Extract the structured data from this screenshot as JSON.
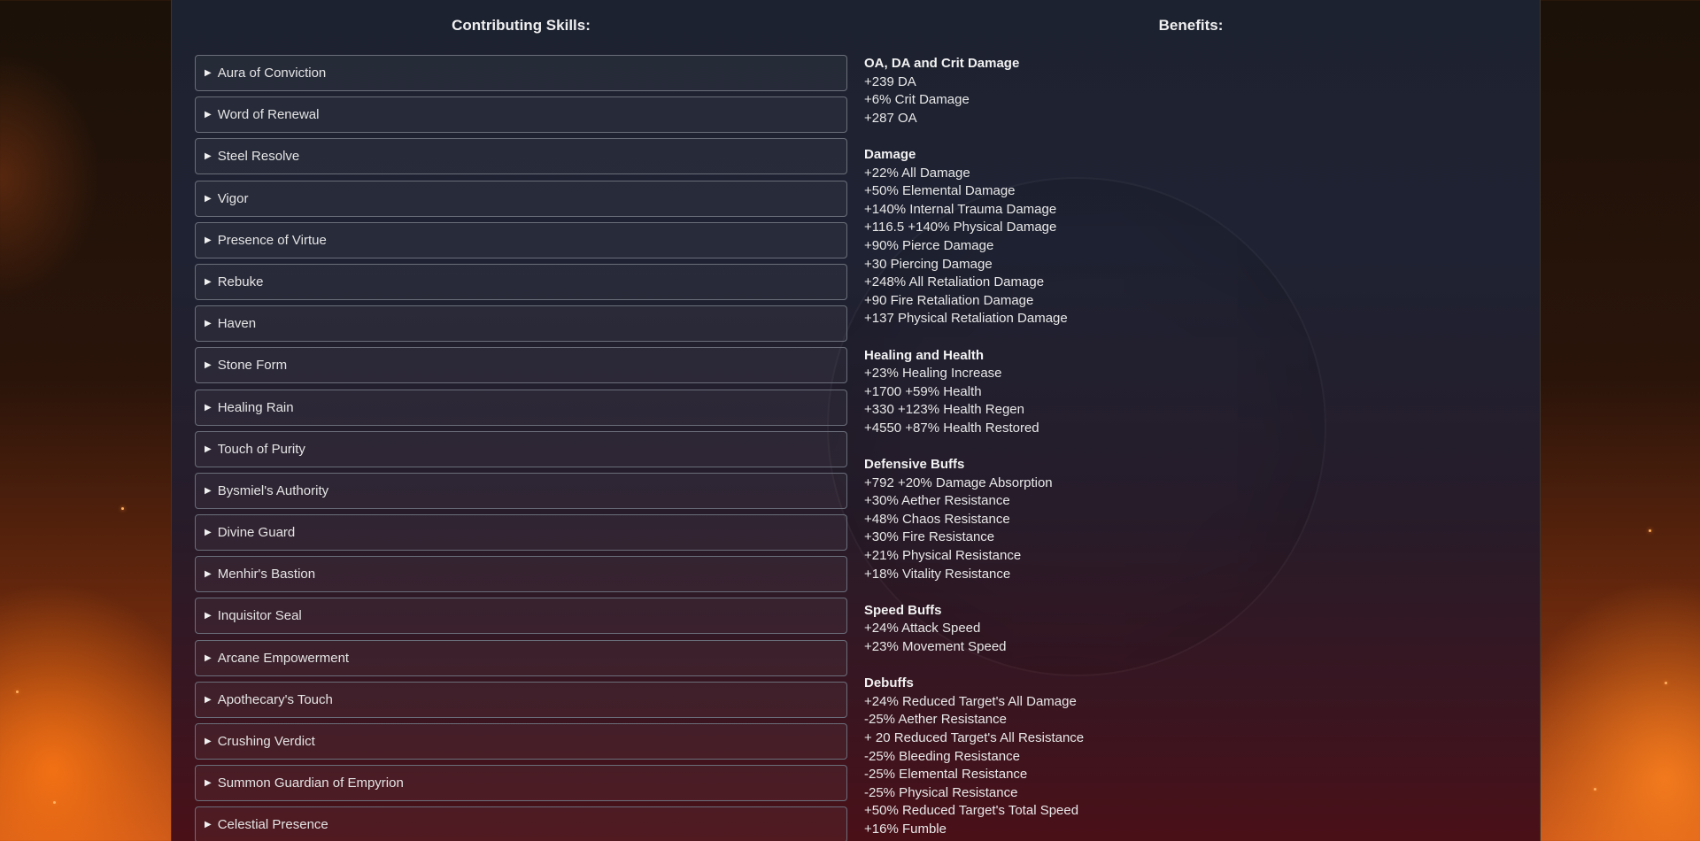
{
  "headings": {
    "skills": "Contributing Skills:",
    "benefits": "Benefits:"
  },
  "skills": [
    "Aura of Conviction",
    "Word of Renewal",
    "Steel Resolve",
    "Vigor",
    "Presence of Virtue",
    "Rebuke",
    "Haven",
    "Stone Form",
    "Healing Rain",
    "Touch of Purity",
    "Bysmiel's Authority",
    "Divine Guard",
    "Menhir's Bastion",
    "Inquisitor Seal",
    "Arcane Empowerment",
    "Apothecary's Touch",
    "Crushing Verdict",
    "Summon Guardian of Empyrion",
    "Celestial Presence"
  ],
  "caret_icon": "▶",
  "benefit_groups": [
    {
      "title": "OA, DA and Crit Damage",
      "lines": [
        "+239 DA",
        "+6% Crit Damage",
        "+287 OA"
      ]
    },
    {
      "title": "Damage",
      "lines": [
        "+22% All Damage",
        "+50% Elemental Damage",
        "+140% Internal Trauma Damage",
        "+116.5 +140% Physical Damage",
        "+90% Pierce Damage",
        "+30 Piercing Damage",
        "+248% All Retaliation Damage",
        "+90 Fire Retaliation Damage",
        "+137 Physical Retaliation Damage"
      ]
    },
    {
      "title": "Healing and Health",
      "lines": [
        "+23% Healing Increase",
        "+1700 +59% Health",
        "+330 +123% Health Regen",
        "+4550 +87% Health Restored"
      ]
    },
    {
      "title": "Defensive Buffs",
      "lines": [
        "+792 +20% Damage Absorption",
        "+30% Aether Resistance",
        "+48% Chaos Resistance",
        "+30% Fire Resistance",
        "+21% Physical Resistance",
        "+18% Vitality Resistance"
      ]
    },
    {
      "title": "Speed Buffs",
      "lines": [
        "+24% Attack Speed",
        "+23% Movement Speed"
      ]
    },
    {
      "title": "Debuffs",
      "lines": [
        "+24% Reduced Target's All Damage",
        "-25% Aether Resistance",
        "+ 20 Reduced Target's All Resistance",
        "-25% Bleeding Resistance",
        "-25% Elemental Resistance",
        "-25% Physical Resistance",
        "+50% Reduced Target's Total Speed",
        "+16% Fumble"
      ]
    }
  ],
  "colors": {
    "panel_top": "#1d2230",
    "panel_bottom": "#4a1018",
    "item_border": "#6a6e7a",
    "text": "#e8e8e8"
  }
}
